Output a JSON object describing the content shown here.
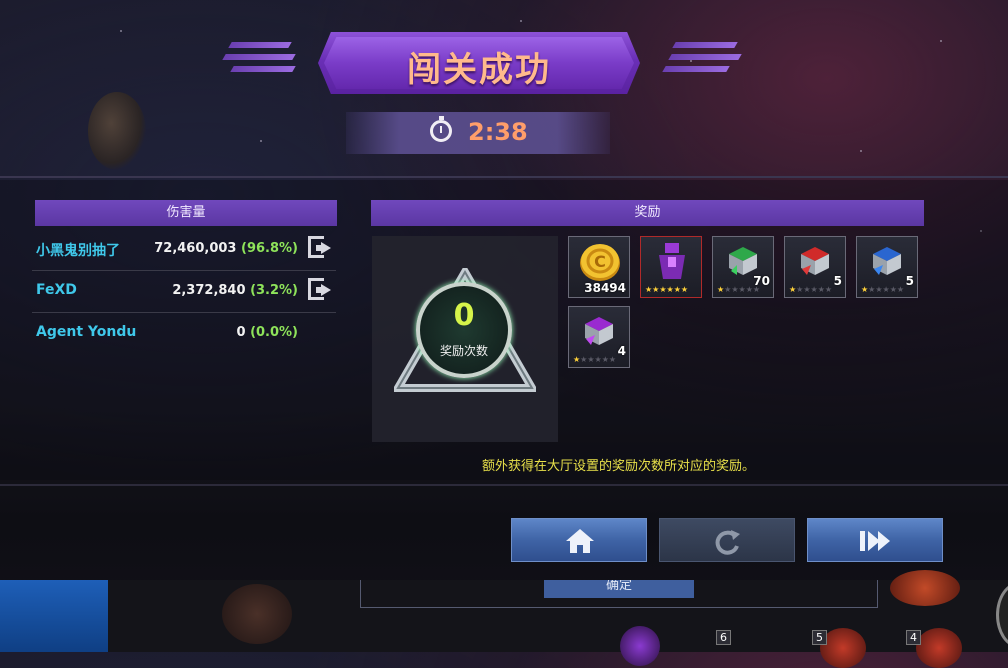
{
  "title": "闯关成功",
  "timer": {
    "icon": "stopwatch-icon",
    "value": "2:38"
  },
  "damage_panel": {
    "header": "伤害量",
    "players": [
      {
        "name": "小黑鬼别抽了",
        "damage": "72,460,003",
        "percent": "(96.8%)",
        "has_exit": true
      },
      {
        "name": "FeXD",
        "damage": "2,372,840",
        "percent": "(3.2%)",
        "has_exit": true
      },
      {
        "name": "Agent Yondu",
        "damage": "0",
        "percent": "(0.0%)",
        "has_exit": false
      }
    ]
  },
  "reward_panel": {
    "header": "奖励",
    "reward_count": "0",
    "reward_count_label": "奖励次数",
    "items": [
      {
        "icon": "gold-coin-icon",
        "qty": "38494",
        "stars": 0
      },
      {
        "icon": "purple-uniform-icon",
        "qty": "",
        "stars": 6
      },
      {
        "icon": "green-iso-cube-icon",
        "qty": "70",
        "stars": 1
      },
      {
        "icon": "red-iso-cube-icon",
        "qty": "5",
        "stars": 1
      },
      {
        "icon": "blue-iso-cube-icon",
        "qty": "5",
        "stars": 1
      },
      {
        "icon": "purple-iso-cube-icon",
        "qty": "4",
        "stars": 1
      }
    ],
    "note": "额外获得在大厅设置的奖励次数所对应的奖励。"
  },
  "buttons": {
    "home": "home-icon",
    "replay": "replay-icon",
    "next": "fast-forward-icon"
  },
  "background_ui": {
    "ok_label": "确定",
    "badges": [
      "6",
      "5",
      "4"
    ]
  },
  "colors": {
    "title": "#ffb98c",
    "timer": "#ff9e6a",
    "player_name": "#3fc8ea",
    "percent": "#8ee35a",
    "note": "#e8e04a",
    "count": "#d6f44a",
    "banner": "#7a3cc8"
  }
}
